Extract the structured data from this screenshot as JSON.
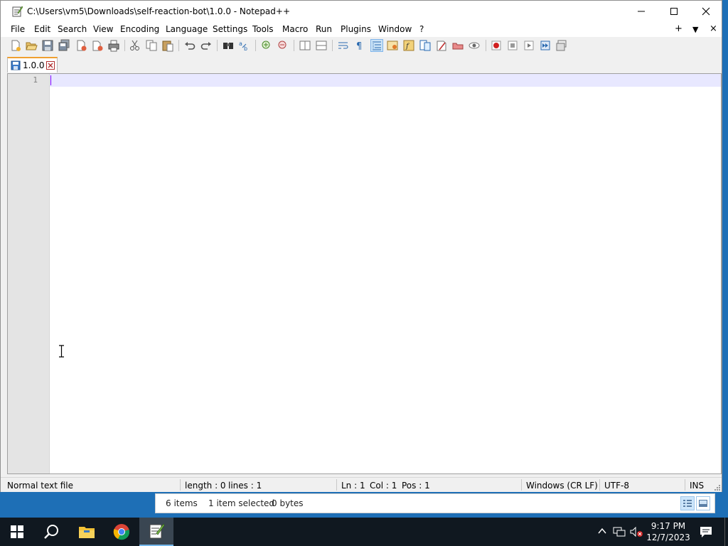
{
  "window": {
    "title": "C:\\Users\\vm5\\Downloads\\self-reaction-bot\\1.0.0 - Notepad++",
    "minimize_icon": "minimize-icon",
    "maximize_icon": "maximize-icon",
    "close_icon": "close-icon"
  },
  "menu": {
    "items": [
      "File",
      "Edit",
      "Search",
      "View",
      "Encoding",
      "Language",
      "Settings",
      "Tools",
      "Macro",
      "Run",
      "Plugins",
      "Window",
      "?"
    ],
    "right_controls": [
      "+",
      "▼",
      "×"
    ]
  },
  "toolbar": {
    "buttons": [
      "new-file-icon",
      "open-file-icon",
      "save-icon",
      "save-all-icon",
      "close-icon",
      "close-all-icon",
      "print-icon",
      "cut-icon",
      "copy-icon",
      "paste-icon",
      "undo-icon",
      "redo-icon",
      "find-icon",
      "replace-icon",
      "zoom-in-icon",
      "zoom-out-icon",
      "sync-vertical-icon",
      "sync-horizontal-icon",
      "word-wrap-icon",
      "show-all-characters-icon",
      "indent-guide-icon",
      "user-language-icon",
      "function-list-icon",
      "folder-workspace-icon",
      "document-map-icon",
      "monitoring-icon",
      "record-macro-icon",
      "stop-recording-icon",
      "playback-macro-icon",
      "run-macro-multiple-icon",
      "save-macro-icon"
    ],
    "pressed": "indent-guide-icon"
  },
  "tab": {
    "label": "1.0.0"
  },
  "editor": {
    "line_numbers": [
      "1"
    ],
    "content": ""
  },
  "status": {
    "file_type": "Normal text file",
    "length": "length : 0",
    "lines": "lines : 1",
    "ln": "Ln : 1",
    "col": "Col : 1",
    "pos": "Pos : 1",
    "eol": "Windows (CR LF)",
    "encoding": "UTF-8",
    "mode": "INS"
  },
  "explorer_status": {
    "items": "6 items",
    "selected": "1 item selected",
    "size": "0 bytes"
  },
  "taskbar": {
    "apps": [
      "start-icon",
      "search-icon",
      "file-explorer-icon",
      "chrome-icon",
      "notepad-plus-plus-icon"
    ],
    "active": "notepad-plus-plus-icon",
    "time": "9:17 PM",
    "date": "12/7/2023"
  }
}
